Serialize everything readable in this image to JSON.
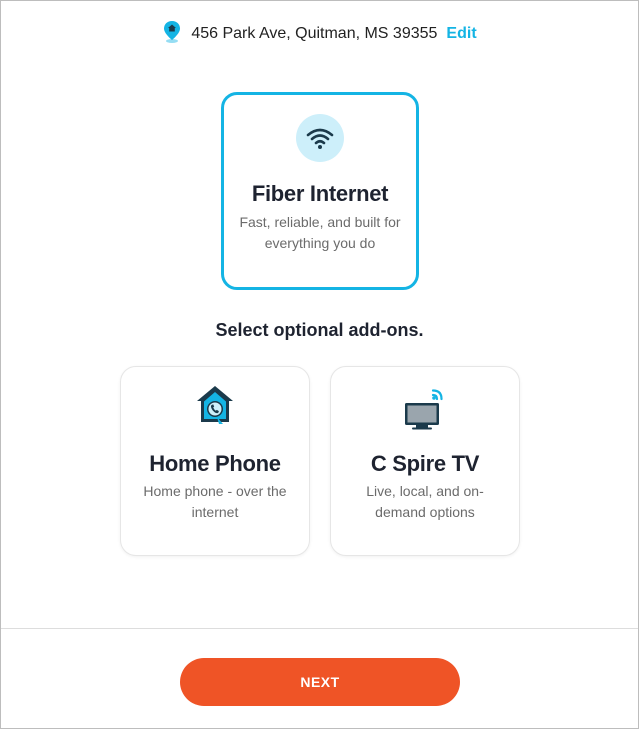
{
  "address": {
    "text": "456 Park Ave, Quitman, MS 39355",
    "edit_label": "Edit",
    "icon": "location-pin-icon"
  },
  "main_service": {
    "title": "Fiber Internet",
    "description": "Fast, reliable, and built for everything you do",
    "icon": "wifi-icon",
    "selected": true
  },
  "addons_heading": "Select optional add-ons.",
  "addons": [
    {
      "title": "Home Phone",
      "description": "Home phone - over the internet",
      "icon": "home-phone-icon"
    },
    {
      "title": "C Spire TV",
      "description": "Live, local, and on-demand options",
      "icon": "tv-icon"
    }
  ],
  "next_label": "NEXT",
  "colors": {
    "accent": "#14b4e4",
    "accent_light": "#cdeffa",
    "button": "#ef5426",
    "icon_dark": "#1b3a4b"
  }
}
